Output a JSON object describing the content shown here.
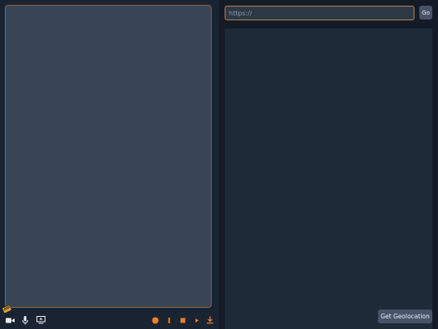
{
  "colors": {
    "accent": "#e8832d",
    "panel_bg": "#1a2332",
    "video_bg": "#394555",
    "button_bg": "#48536a"
  },
  "media_controls": {
    "left": [
      {
        "icon": "camera-icon"
      },
      {
        "icon": "microphone-icon"
      },
      {
        "icon": "screen-share-icon"
      }
    ],
    "right": [
      {
        "icon": "record-icon"
      },
      {
        "icon": "pause-icon"
      },
      {
        "icon": "stop-icon"
      },
      {
        "icon": "play-icon"
      },
      {
        "icon": "download-icon"
      }
    ]
  },
  "browser": {
    "url_value": "",
    "url_placeholder": "https://",
    "go_label": "Go",
    "geolocation_label": "Get Geolocation"
  }
}
